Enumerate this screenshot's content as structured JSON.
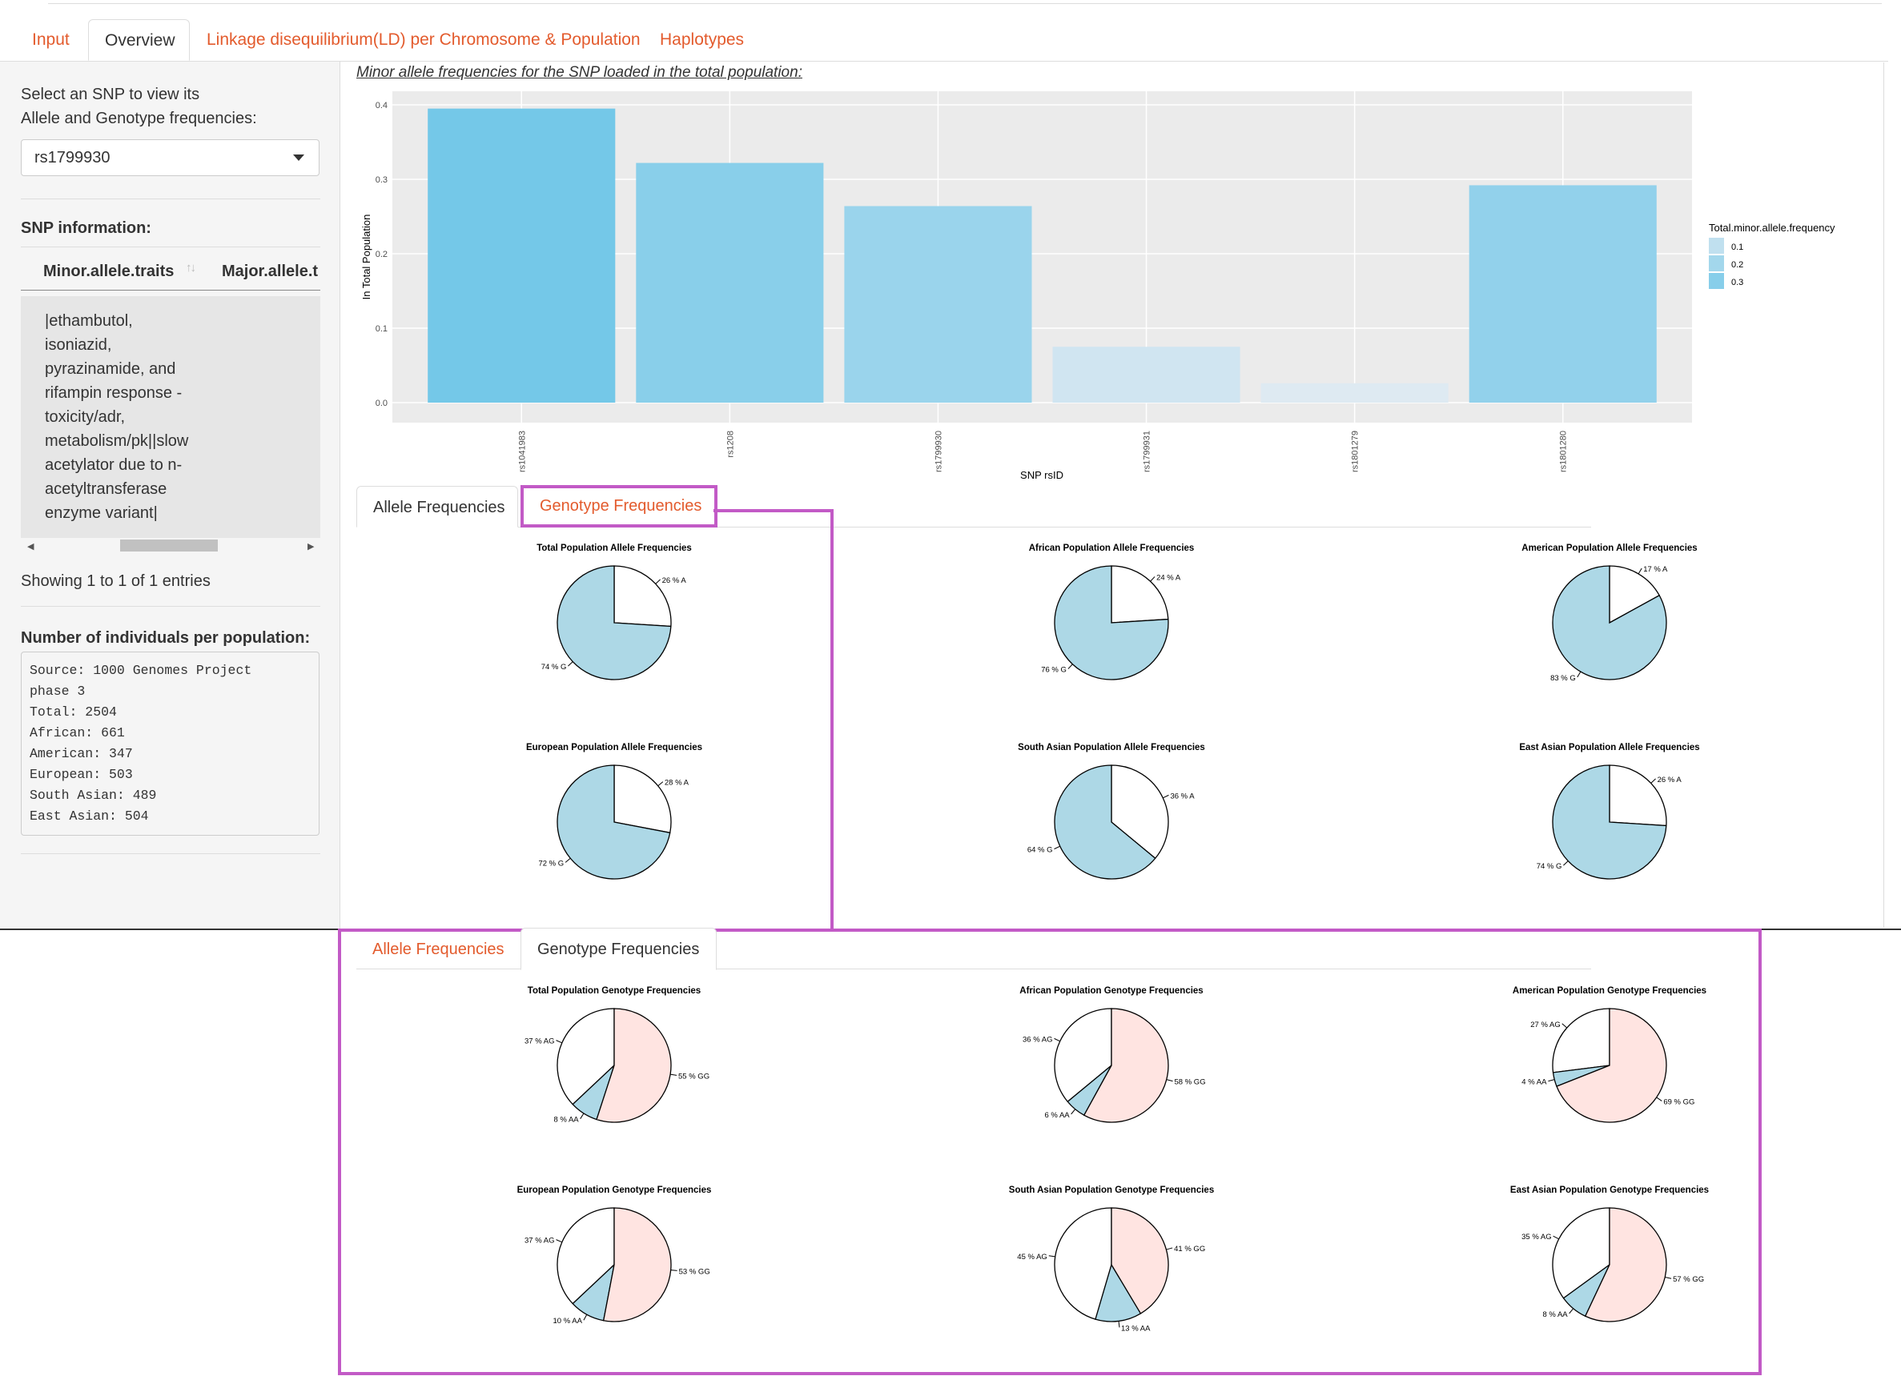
{
  "nav": {
    "tabs": [
      {
        "label": "Input"
      },
      {
        "label": "Overview"
      },
      {
        "label": "Linkage disequilibrium(LD) per Chromosome & Population"
      },
      {
        "label": "Haplotypes"
      }
    ]
  },
  "sidebar": {
    "select_prompt_line1": "Select an SNP to view its",
    "select_prompt_line2": "Allele and Genotype frequencies:",
    "selected_snp": "rs1799930",
    "snp_info_heading": "SNP information:",
    "table": {
      "columns": [
        "Minor.allele.traits",
        "Major.allele.t"
      ],
      "sort_glyph": "↑↓",
      "cell_lines": [
        "|ethambutol,",
        "isoniazid,",
        "pyrazinamide, and",
        "rifampin response -",
        "toxicity/adr,",
        "metabolism/pk||slow",
        "acetylator due to n-",
        "acetyltransferase",
        "enzyme variant|"
      ],
      "footer": "Showing 1 to 1 of 1 entries"
    },
    "individuals_heading": "Number of individuals per population:",
    "individuals_text": "Source: 1000 Genomes Project\nphase 3\nTotal: 2504\nAfrican: 661\nAmerican: 347\nEuropean: 503\nSouth Asian: 489\nEast Asian: 504"
  },
  "main": {
    "bar_section_title": "Minor allele frequencies for the SNP loaded in the total population:",
    "subtabs": {
      "allele": "Allele Frequencies",
      "genotype": "Genotype Frequencies"
    }
  },
  "colors": {
    "accent": "#e35b2d",
    "highlight": "#c25ac6",
    "pie_blue": "#add8e6",
    "pie_pink": "#ffe4e1"
  },
  "chart_data": [
    {
      "type": "bar",
      "xlabel": "SNP rsID",
      "ylabel": "In Total Population",
      "categories": [
        "rs1041983",
        "rs1208",
        "rs1799930",
        "rs1799931",
        "rs1801279",
        "rs1801280"
      ],
      "values": [
        0.395,
        0.322,
        0.264,
        0.075,
        0.026,
        0.292
      ],
      "ylim": [
        0,
        0.42
      ],
      "yticks": [
        "0.0",
        "0.1",
        "0.2",
        "0.3",
        "0.4"
      ],
      "grid": true,
      "legend": {
        "title": "Total.minor.allele.frequency",
        "entries": [
          "0.1",
          "0.2",
          "0.3"
        ],
        "placement": "right"
      }
    },
    {
      "type": "pie",
      "group": "allele",
      "pies": [
        {
          "title": "Total Population Allele Frequencies",
          "slices": [
            {
              "label": "26 % A",
              "value": 26
            },
            {
              "label": "74 % G",
              "value": 74
            }
          ]
        },
        {
          "title": "African Population Allele Frequencies",
          "slices": [
            {
              "label": "24 % A",
              "value": 24
            },
            {
              "label": "76 % G",
              "value": 76
            }
          ]
        },
        {
          "title": "American Population Allele Frequencies",
          "slices": [
            {
              "label": "17 % A",
              "value": 17
            },
            {
              "label": "83 % G",
              "value": 83
            }
          ]
        },
        {
          "title": "European Population Allele Frequencies",
          "slices": [
            {
              "label": "28 % A",
              "value": 28
            },
            {
              "label": "72 % G",
              "value": 72
            }
          ]
        },
        {
          "title": "South Asian Population Allele Frequencies",
          "slices": [
            {
              "label": "36 % A",
              "value": 36
            },
            {
              "label": "64 % G",
              "value": 64
            }
          ]
        },
        {
          "title": "East Asian Population Allele Frequencies",
          "slices": [
            {
              "label": "26 % A",
              "value": 26
            },
            {
              "label": "74 % G",
              "value": 74
            }
          ]
        }
      ]
    },
    {
      "type": "pie",
      "group": "genotype",
      "pies": [
        {
          "title": "Total Population Genotype Frequencies",
          "slices": [
            {
              "label": "37 % AG",
              "value": 37
            },
            {
              "label": "8 % AA",
              "value": 8
            },
            {
              "label": "55 % GG",
              "value": 55
            }
          ]
        },
        {
          "title": "African Population Genotype Frequencies",
          "slices": [
            {
              "label": "36 % AG",
              "value": 36
            },
            {
              "label": "6 % AA",
              "value": 6
            },
            {
              "label": "58 % GG",
              "value": 58
            }
          ]
        },
        {
          "title": "American Population Genotype Frequencies",
          "slices": [
            {
              "label": "27 % AG",
              "value": 27
            },
            {
              "label": "4 % AA",
              "value": 4
            },
            {
              "label": "69 % GG",
              "value": 69
            }
          ]
        },
        {
          "title": "European Population Genotype Frequencies",
          "slices": [
            {
              "label": "37 % AG",
              "value": 37
            },
            {
              "label": "10 % AA",
              "value": 10
            },
            {
              "label": "53 % GG",
              "value": 53
            }
          ]
        },
        {
          "title": "South Asian Population Genotype Frequencies",
          "slices": [
            {
              "label": "45 % AG",
              "value": 45
            },
            {
              "label": "13 % AA",
              "value": 13
            },
            {
              "label": "41 % GG",
              "value": 41
            }
          ]
        },
        {
          "title": "East Asian Population Genotype Frequencies",
          "slices": [
            {
              "label": "35 % AG",
              "value": 35
            },
            {
              "label": "8 % AA",
              "value": 8
            },
            {
              "label": "57 % GG",
              "value": 57
            }
          ]
        }
      ]
    }
  ]
}
